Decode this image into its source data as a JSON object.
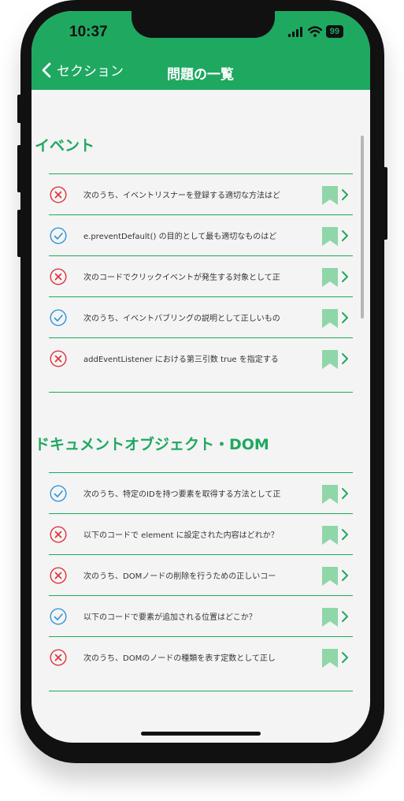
{
  "status_bar": {
    "time": "10:37",
    "battery": "99"
  },
  "nav": {
    "back_label": "セクション",
    "title": "問題の一覧"
  },
  "colors": {
    "accent": "#1fa860",
    "wrong": "#e0303a",
    "correct": "#2f93d8",
    "bookmark": "#8fd6a8"
  },
  "sections": [
    {
      "title": "イベント",
      "questions": [
        {
          "status": "wrong",
          "text": "次のうち、イベントリスナーを登録する適切な方法はど"
        },
        {
          "status": "correct",
          "text": "e.preventDefault() の目的として最も適切なものはど"
        },
        {
          "status": "wrong",
          "text": "次のコードでクリックイベントが発生する対象として正"
        },
        {
          "status": "correct",
          "text": "次のうち、イベントバブリングの説明として正しいもの"
        },
        {
          "status": "wrong",
          "text": "addEventListener における第三引数 true を指定する"
        }
      ]
    },
    {
      "title": "ドキュメントオブジェクト・DOM",
      "questions": [
        {
          "status": "correct",
          "text": "次のうち、特定のIDを持つ要素を取得する方法として正"
        },
        {
          "status": "wrong",
          "text": "以下のコードで element に設定された内容はどれか？"
        },
        {
          "status": "wrong",
          "text": "次のうち、DOMノードの削除を行うための正しいコー"
        },
        {
          "status": "correct",
          "text": "以下のコードで要素が追加される位置はどこか？"
        },
        {
          "status": "wrong",
          "text": "次のうち、DOMのノードの種類を表す定数として正し"
        }
      ]
    }
  ]
}
